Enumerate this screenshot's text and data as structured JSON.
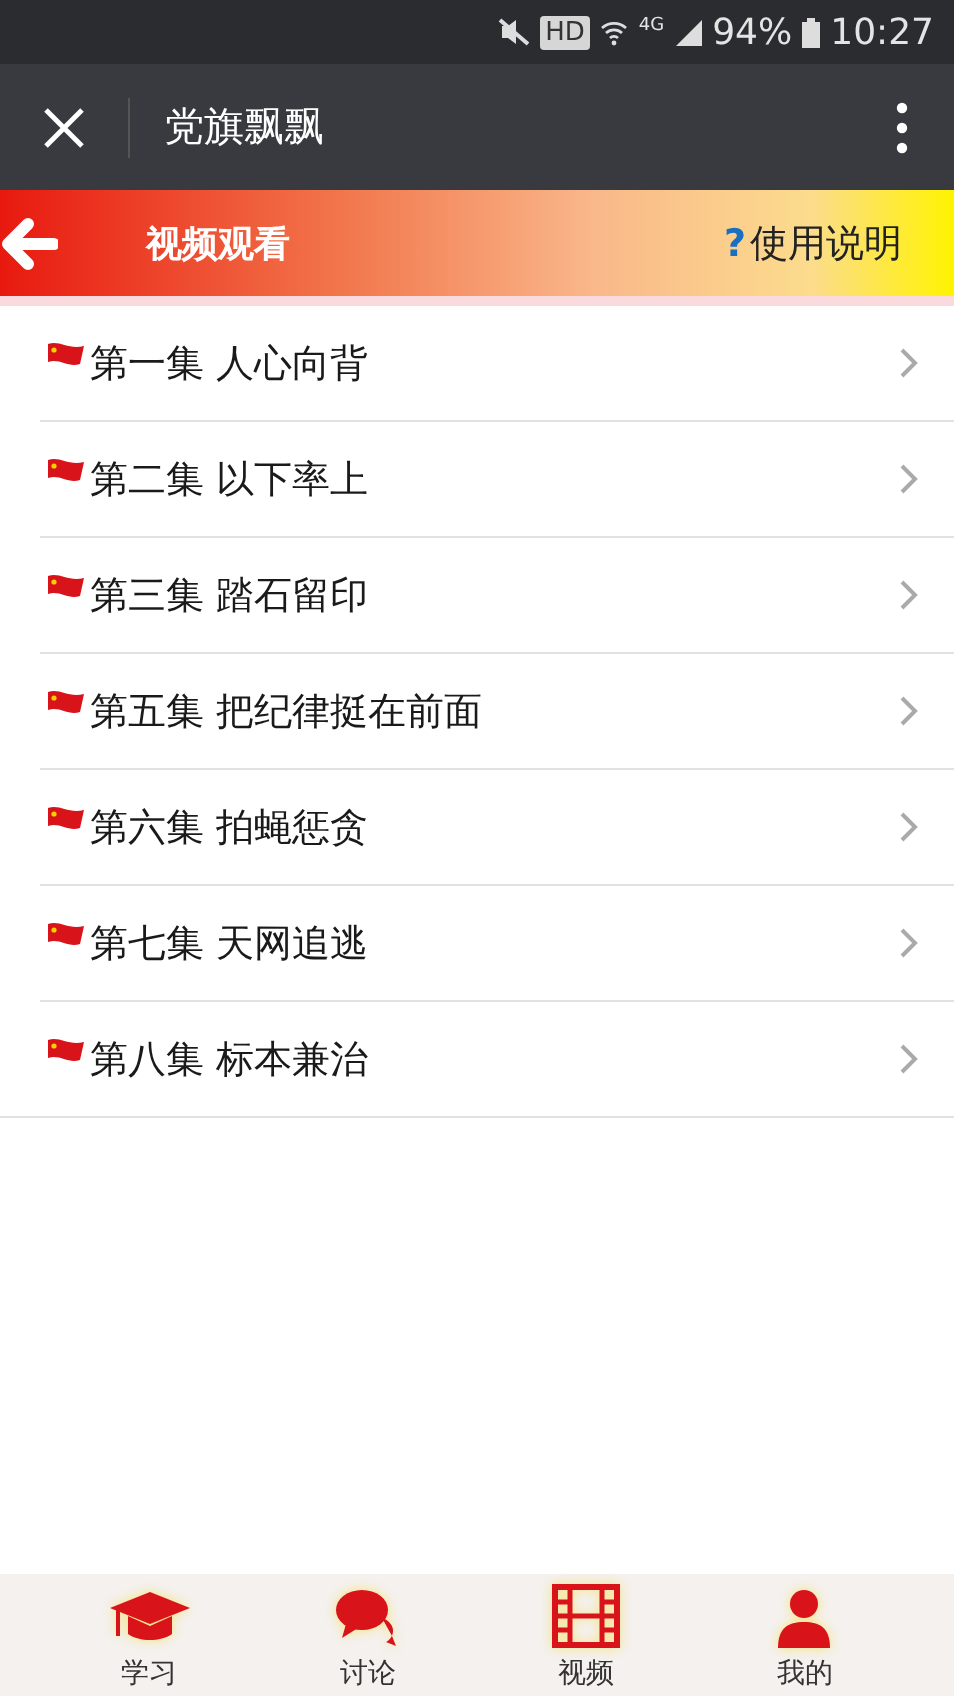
{
  "status_bar": {
    "hd": "HD",
    "network": "4G",
    "battery": "94%",
    "time": "10:27"
  },
  "title_bar": {
    "title": "党旗飘飘"
  },
  "header": {
    "title": "视频观看",
    "help_mark": "?",
    "help": "使用说明"
  },
  "episodes": [
    {
      "title": "第一集 人心向背"
    },
    {
      "title": "第二集 以下率上"
    },
    {
      "title": "第三集 踏石留印"
    },
    {
      "title": "第五集 把纪律挺在前面"
    },
    {
      "title": "第六集 拍蝇惩贪"
    },
    {
      "title": "第七集 天网追逃"
    },
    {
      "title": "第八集 标本兼治"
    }
  ],
  "tabs": [
    {
      "kind": "cap",
      "label": "学习"
    },
    {
      "kind": "chat",
      "label": "讨论"
    },
    {
      "kind": "film",
      "label": "视频"
    },
    {
      "kind": "person",
      "label": "我的"
    }
  ]
}
